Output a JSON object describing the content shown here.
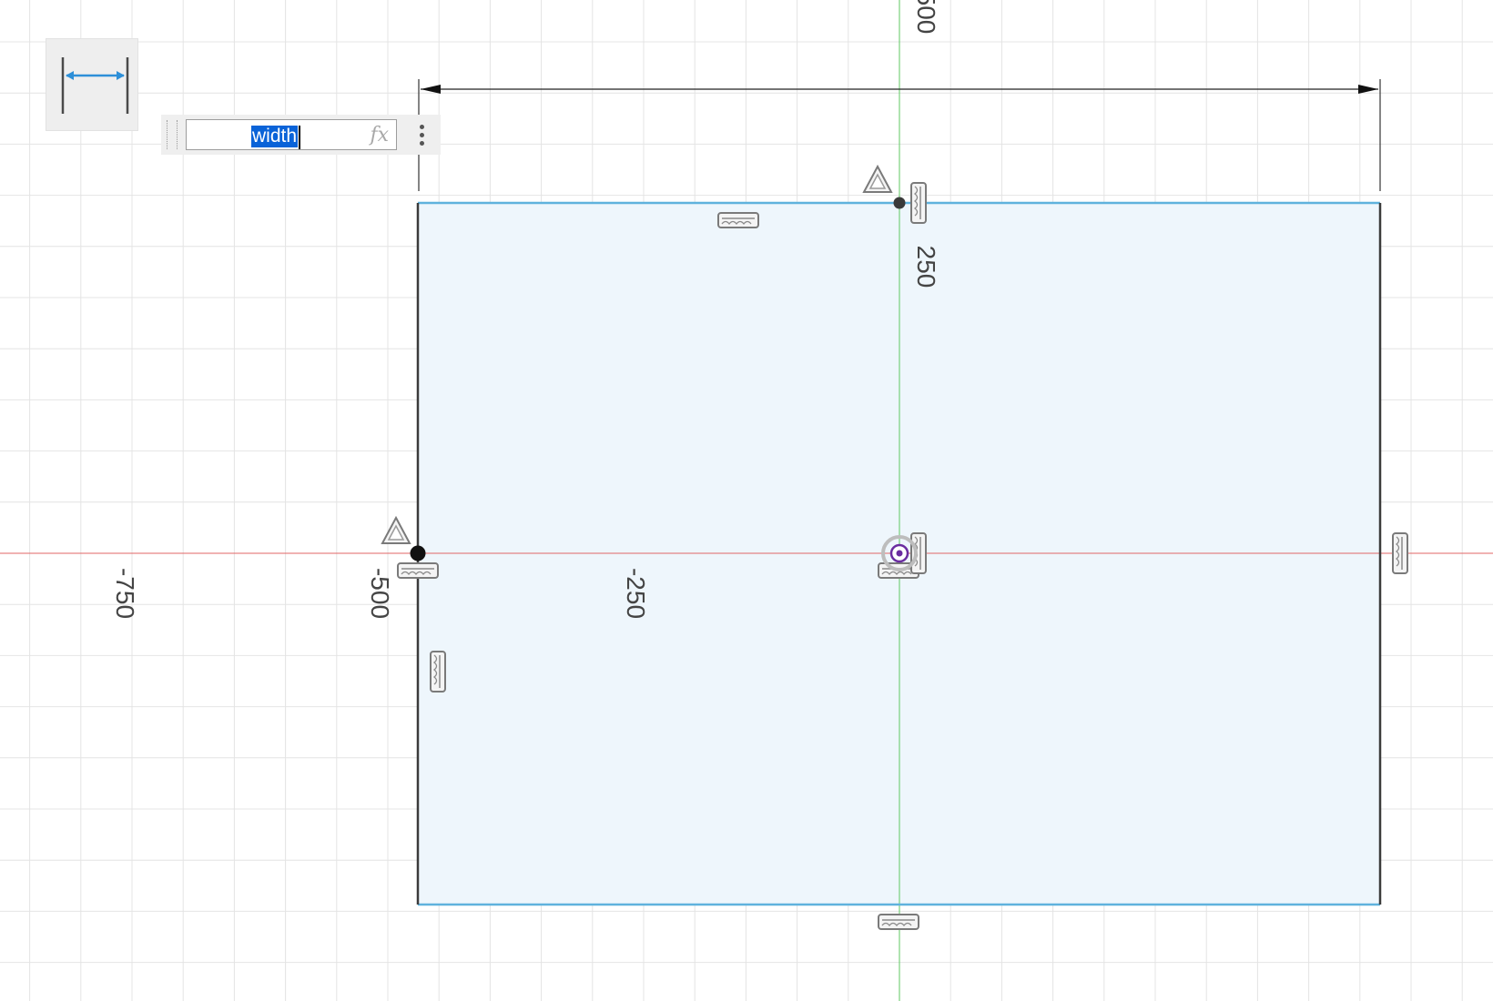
{
  "canvas": {
    "grid_color": "#e4e4e4",
    "x_axis_color": "#e06666",
    "y_axis_color": "#5fc862",
    "sketch_fill": "#eef6fc",
    "sketch_edge_selected": "#5fb2dd",
    "sketch_edge": "#3b3b3b",
    "origin_color": "#6a2ca0"
  },
  "axis_labels": {
    "x_minus_750": "-750",
    "x_minus_500": "-500",
    "x_minus_250": "-250",
    "y_250": "250",
    "y_500": "500"
  },
  "toolbar": {
    "tool_icon": "linear-dimension-icon"
  },
  "dimension_input": {
    "value": "width",
    "function_label": "fx",
    "more_icon": "vertical-ellipsis-icon"
  }
}
